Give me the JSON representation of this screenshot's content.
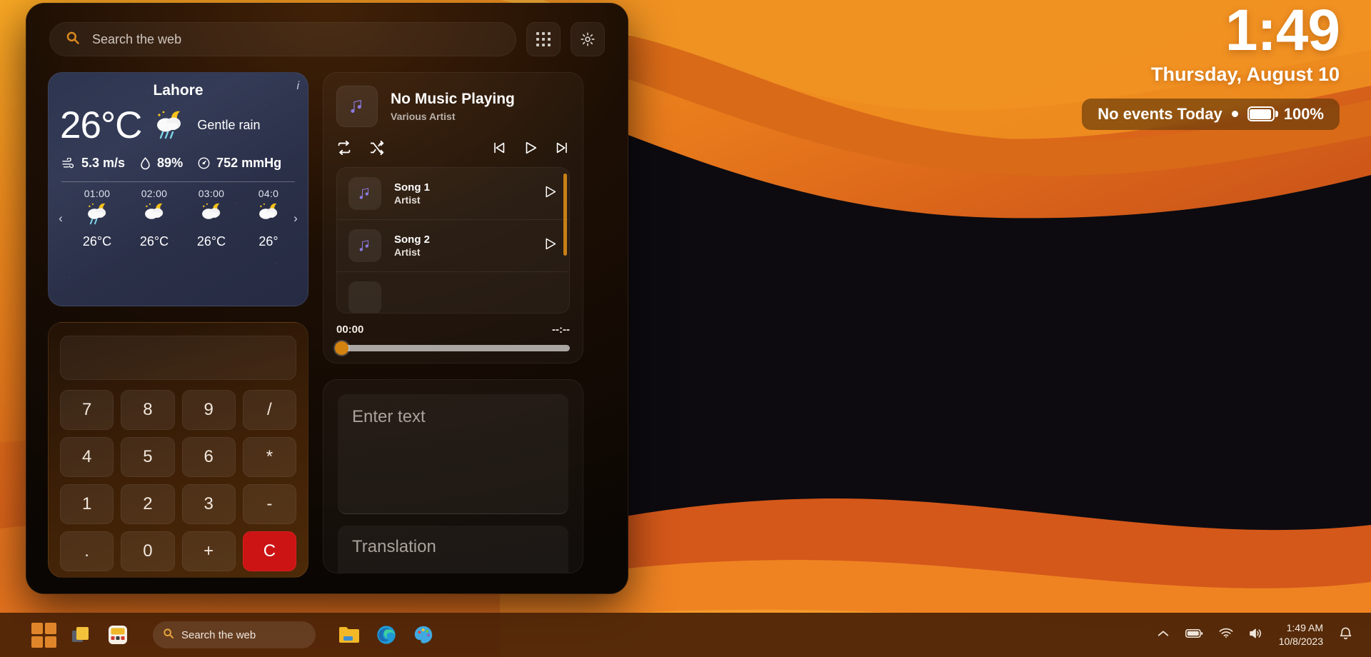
{
  "clock": {
    "time": "1:49",
    "date": "Thursday, August 10",
    "events": "No events Today",
    "battery": "100%",
    "battery_icon": "battery-full-icon",
    "separator_icon": "dot-separator-icon"
  },
  "panel": {
    "search": {
      "placeholder": "Search the web",
      "icon": "search-icon"
    },
    "apps_button_icon": "apps-grid-icon",
    "settings_button_icon": "gear-icon"
  },
  "weather": {
    "city": "Lahore",
    "info_icon": "info-icon",
    "temperature": "26°C",
    "condition": "Gentle rain",
    "condition_icon": "cloud-moon-rain-icon",
    "wind": "5.3 m/s",
    "wind_icon": "wind-icon",
    "humidity": "89%",
    "humidity_icon": "droplet-icon",
    "pressure": "752 mmHg",
    "pressure_icon": "gauge-icon",
    "prev_icon": "chevron-left-icon",
    "next_icon": "chevron-right-icon",
    "hours": [
      {
        "time": "01:00",
        "icon": "cloud-moon-rain-icon",
        "temp": "26°C"
      },
      {
        "time": "02:00",
        "icon": "cloud-moon-icon",
        "temp": "26°C"
      },
      {
        "time": "03:00",
        "icon": "cloud-moon-icon",
        "temp": "26°C"
      },
      {
        "time": "04:0",
        "icon": "cloud-moon-icon",
        "temp": "26°"
      }
    ]
  },
  "calculator": {
    "display_value": "",
    "keys": [
      "7",
      "8",
      "9",
      "/",
      "4",
      "5",
      "6",
      "*",
      "1",
      "2",
      "3",
      "-",
      ".",
      "0",
      "+",
      "C"
    ],
    "clear_key": "C"
  },
  "music": {
    "title": "No Music Playing",
    "artist": "Various Artist",
    "art_icon": "music-note-icon",
    "repeat_icon": "repeat-icon",
    "shuffle_icon": "shuffle-icon",
    "prev_icon": "skip-previous-icon",
    "play_icon": "play-icon",
    "next_icon": "skip-next-icon",
    "elapsed": "00:00",
    "remaining": "--:--",
    "songs": [
      {
        "title": "Song 1",
        "artist": "Artist",
        "icon": "music-note-icon",
        "play_icon": "play-icon"
      },
      {
        "title": "Song 2",
        "artist": "Artist",
        "icon": "music-note-icon",
        "play_icon": "play-icon"
      }
    ]
  },
  "translate": {
    "input_placeholder": "Enter text",
    "output_placeholder": "Translation"
  },
  "taskbar": {
    "start_icon": "windows-start-icon",
    "taskview_icon": "task-view-icon",
    "widgets_icon": "widgets-icon",
    "search": {
      "placeholder": "Search the web",
      "icon": "search-icon"
    },
    "explorer_icon": "file-explorer-icon",
    "edge_icon": "edge-browser-icon",
    "paint_icon": "paint-icon",
    "tray": {
      "overflow_icon": "show-hidden-icons-icon",
      "battery_icon": "battery-icon",
      "wifi_icon": "wifi-icon",
      "volume_icon": "volume-icon",
      "notification_icon": "notification-bell-icon"
    },
    "clock_time": "1:49 AM",
    "clock_date": "10/8/2023"
  },
  "colors": {
    "accent_orange": "#d3820f",
    "wallpaper_top": "#f5a623",
    "wallpaper_bottom": "#9e3416",
    "clear_red": "#cc1414",
    "music_purple": "#8b7ae0"
  }
}
